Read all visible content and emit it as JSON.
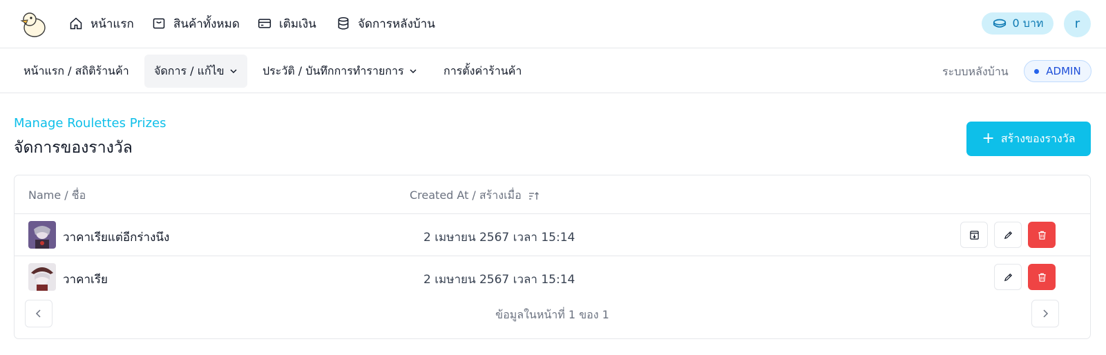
{
  "top_nav": {
    "items": [
      {
        "label": "หน้าแรก",
        "icon": "home-icon"
      },
      {
        "label": "สินค้าทั้งหมด",
        "icon": "store-icon"
      },
      {
        "label": "เติมเงิน",
        "icon": "credit-card-icon"
      },
      {
        "label": "จัดการหลังบ้าน",
        "icon": "database-icon"
      }
    ],
    "balance": "0 บาท",
    "avatar_initial": "r"
  },
  "sub_nav": {
    "items": [
      {
        "label": "หน้าแรก / สถิติร้านค้า"
      },
      {
        "label": "จัดการ / แก้ไข",
        "active": true
      },
      {
        "label": "ประวัติ / บันทึกการทำรายการ"
      },
      {
        "label": "การตั้งค่าร้านค้า"
      }
    ],
    "backend_label": "ระบบหลังบ้าน",
    "role_badge": "ADMIN"
  },
  "page": {
    "subtitle": "Manage Roulettes Prizes",
    "title": "จัดการของรางวัล",
    "create_button": "สร้างของรางวัล"
  },
  "table": {
    "columns": {
      "name": "Name / ชื่อ",
      "created_at": "Created At / สร้างเมื่อ"
    },
    "rows": [
      {
        "name": "วาคาเรียแต่อีกร่างนึง",
        "created_at": "2 เมษายน 2567 เวลา 15:14",
        "actions": [
          "archive",
          "edit",
          "delete"
        ]
      },
      {
        "name": "วาคาเรีย",
        "created_at": "2 เมษายน 2567 เวลา 15:14",
        "actions": [
          "edit",
          "delete"
        ]
      }
    ],
    "pagination": "ข้อมูลในหน้าที่ 1 ของ 1"
  },
  "colors": {
    "accent": "#0ebfe9",
    "danger": "#ef4444",
    "badge_blue": "#1d4ed8"
  }
}
